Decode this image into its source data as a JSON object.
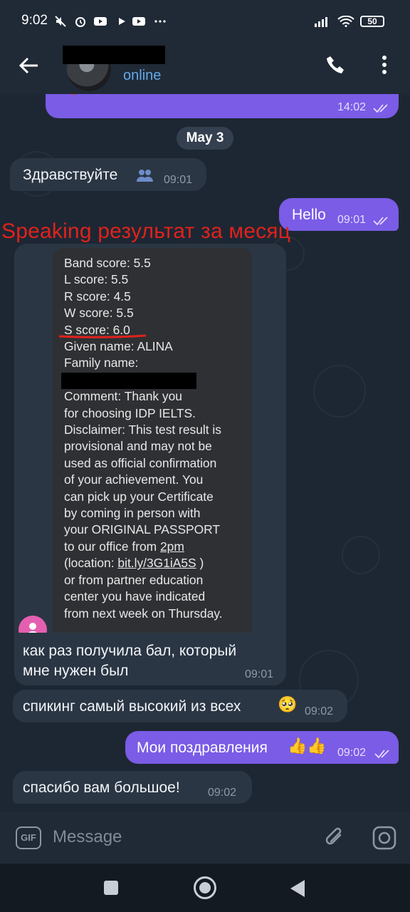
{
  "status_bar": {
    "time": "9:02",
    "battery": "50",
    "icons": [
      "mute-icon",
      "alarm-icon",
      "youtube-icon",
      "play-icon",
      "youtube-icon",
      "more-dots-icon",
      "signal-icon",
      "wifi-icon",
      "battery-icon"
    ]
  },
  "header": {
    "status": "online"
  },
  "chat": {
    "prev_out_time": "14:02",
    "date": "May 3",
    "msg1": {
      "text": "Здравствуйте",
      "time": "09:01"
    },
    "msg2": {
      "text": "Hello",
      "time": "09:01"
    },
    "annotation": "Speaking результат за месяц",
    "screenshot_lines": {
      "l1": "Band score: 5.5",
      "l2": "L score: 5.5",
      "l3": "R score: 4.5",
      "l4": "W score: 5.5",
      "l5": "S score: 6.0",
      "l6": "Given name: ALINA",
      "l7": "Family name:",
      "l8": "Comment: Thank you",
      "l9": "for choosing IDP IELTS.",
      "l10": "Disclaimer: This test result is",
      "l11": "provisional and may not be",
      "l12": "used as official confirmation",
      "l13": "of your achievement. You",
      "l14": "can pick up your Certificate",
      "l15": "by coming in person with",
      "l16": "your ORIGINAL PASSPORT",
      "l17a": "to our office from ",
      "l17b": "2pm",
      "l18a": "(location: ",
      "l18b": "bit.ly/3G1iA5S",
      "l18c": " )",
      "l19": "or from partner education",
      "l20": "center you have indicated",
      "l21": "from next week on Thursday."
    },
    "msg3": {
      "line1": "как раз получила бал, который",
      "line2": "мне нужен был",
      "time": "09:01"
    },
    "msg4": {
      "text": "спикинг самый высокий из всех",
      "emoji": "🥺",
      "time": "09:02"
    },
    "msg5": {
      "text": "Мои поздравления",
      "emoji": "👍👍",
      "time": "09:02"
    },
    "msg6": {
      "text": "спасибо вам большое!",
      "time": "09:02"
    }
  },
  "input": {
    "gif_label": "GIF",
    "placeholder": "Message"
  },
  "colors": {
    "outgoing_bubble": "#7a5ce6",
    "incoming_bubble": "#2b3644",
    "accent_online": "#62a9e9",
    "annotation_red": "#e0221c"
  }
}
